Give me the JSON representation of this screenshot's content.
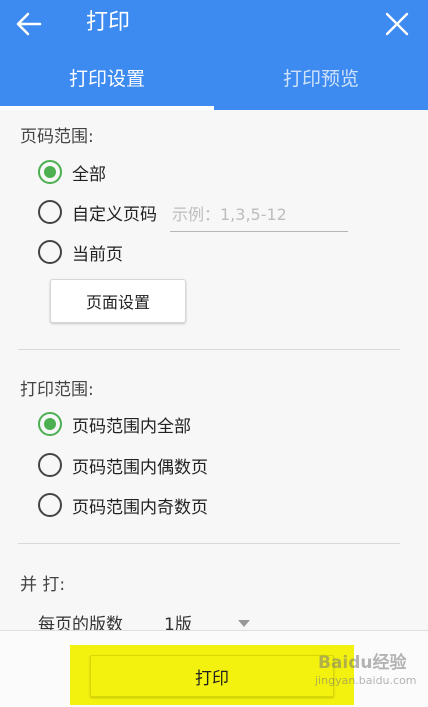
{
  "header": {
    "title": "打印",
    "back_icon": "arrow-left-icon",
    "close_icon": "close-icon",
    "background_color": "#3d8af0"
  },
  "tabs": [
    {
      "label": "打印设置",
      "active": true
    },
    {
      "label": "打印预览",
      "active": false
    }
  ],
  "page_range": {
    "label": "页码范围:",
    "options": [
      {
        "label": "全部",
        "checked": true
      },
      {
        "label": "自定义页码",
        "checked": false
      },
      {
        "label": "当前页",
        "checked": false
      }
    ],
    "custom_input_value": "",
    "custom_input_placeholder": "示例：1,3,5-12",
    "page_setup_button": "页面设置"
  },
  "print_range": {
    "label": "打印范围:",
    "options": [
      {
        "label": "页码范围内全部",
        "checked": true
      },
      {
        "label": "页码范围内偶数页",
        "checked": false
      },
      {
        "label": "页码范围内奇数页",
        "checked": false
      }
    ]
  },
  "combine": {
    "label": "并 打:",
    "pages_per_sheet_label": "每页的版数",
    "pages_per_sheet_value": "1版"
  },
  "print_button": "打印",
  "accent_color": "#4caf50",
  "highlight_color": "#f3f20f",
  "watermark": {
    "text": "Baidu经验",
    "sub": "jingyan.baidu.com"
  }
}
